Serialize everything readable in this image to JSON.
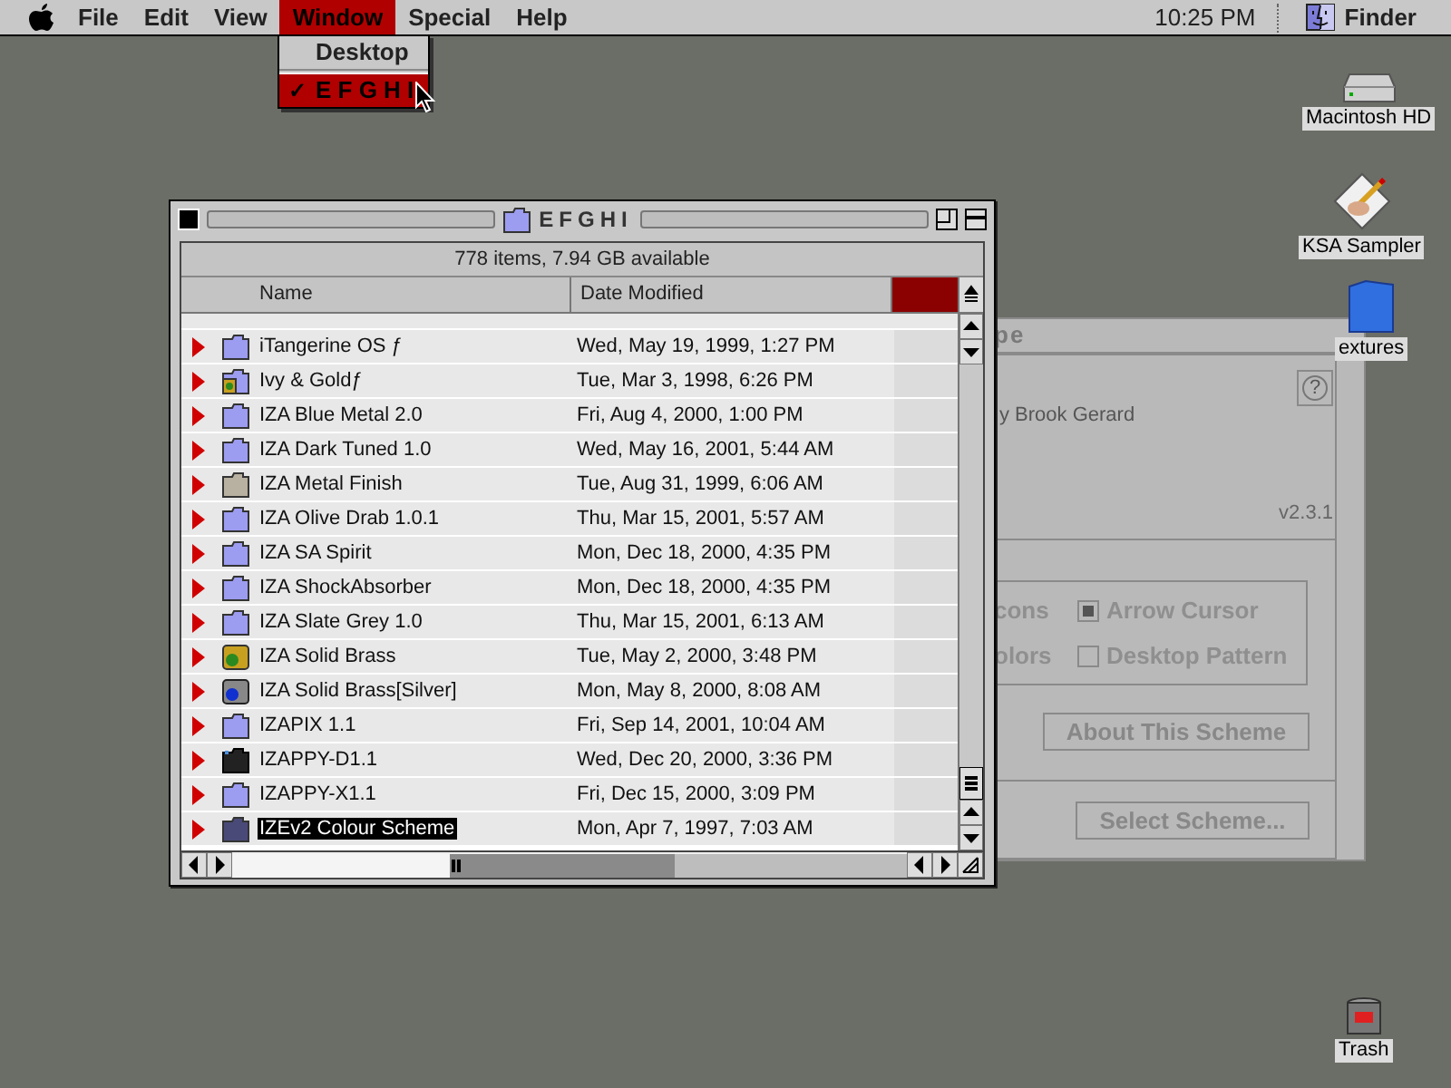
{
  "menu_bar": {
    "items": [
      {
        "label": "File",
        "selected": false
      },
      {
        "label": "Edit",
        "selected": false
      },
      {
        "label": "View",
        "selected": false
      },
      {
        "label": "Window",
        "selected": true
      },
      {
        "label": "Special",
        "selected": false
      },
      {
        "label": "Help",
        "selected": false
      }
    ],
    "clock": "10:25 PM",
    "app": "Finder"
  },
  "window_menu": {
    "items": [
      {
        "label": "Desktop",
        "checked": false,
        "highlighted": false
      },
      {
        "label": "E F G H I",
        "checked": true,
        "highlighted": true
      }
    ],
    "check_mark": "✓"
  },
  "finder_window": {
    "title": "EFGHI",
    "info": "778 items, 7.94 GB available",
    "columns": [
      "Name",
      "Date Modified"
    ],
    "rows": [
      {
        "name": "iTangerine OS ƒ",
        "date": "Wed, May 19, 1999, 1:27 PM",
        "kind": "folder",
        "selected": false
      },
      {
        "name": "Ivy & Goldƒ",
        "date": "Tue, Mar 3, 1998, 6:26 PM",
        "kind": "app-folder",
        "selected": false
      },
      {
        "name": "IZA Blue Metal 2.0",
        "date": "Fri, Aug 4, 2000, 1:00 PM",
        "kind": "folder",
        "selected": false
      },
      {
        "name": "IZA Dark Tuned 1.0",
        "date": "Wed, May 16, 2001, 5:44 AM",
        "kind": "folder",
        "selected": false
      },
      {
        "name": "IZA Metal Finish",
        "date": "Tue, Aug 31, 1999, 6:06 AM",
        "kind": "gray-folder",
        "selected": false
      },
      {
        "name": "IZA Olive Drab 1.0.1",
        "date": "Thu, Mar 15, 2001, 5:57 AM",
        "kind": "folder",
        "selected": false
      },
      {
        "name": "IZA SA Spirit",
        "date": "Mon, Dec 18, 2000, 4:35 PM",
        "kind": "folder",
        "selected": false
      },
      {
        "name": "IZA ShockAbsorber",
        "date": "Mon, Dec 18, 2000, 4:35 PM",
        "kind": "folder",
        "selected": false
      },
      {
        "name": "IZA Slate Grey 1.0",
        "date": "Thu, Mar 15, 2001, 6:13 AM",
        "kind": "folder",
        "selected": false
      },
      {
        "name": "IZA Solid Brass",
        "date": "Tue, May 2, 2000, 3:48 PM",
        "kind": "brass-app",
        "selected": false
      },
      {
        "name": "IZA Solid Brass[Silver]",
        "date": "Mon, May 8, 2000, 8:08 AM",
        "kind": "silver-app",
        "selected": false
      },
      {
        "name": "IZAPIX 1.1",
        "date": "Fri, Sep 14, 2001, 10:04 AM",
        "kind": "folder",
        "selected": false
      },
      {
        "name": "IZAPPY-D1.1",
        "date": "Wed, Dec 20, 2000, 3:36 PM",
        "kind": "black-folder",
        "selected": false
      },
      {
        "name": "IZAPPY-X1.1",
        "date": "Fri, Dec 15, 2000, 3:09 PM",
        "kind": "folder",
        "selected": false
      },
      {
        "name": "IZEv2 Colour Scheme",
        "date": "Mon, Apr 7, 1997, 7:03 AM",
        "kind": "folder",
        "selected": true
      }
    ]
  },
  "scheme_window": {
    "title": "pe",
    "help": "?",
    "author": "y Brook Gerard",
    "version": "v2.3.1",
    "options": [
      {
        "label": "cons",
        "kind": "text"
      },
      {
        "label": "Arrow Cursor",
        "kind": "checkbox",
        "checked": true
      },
      {
        "label": "olors",
        "kind": "text"
      },
      {
        "label": "Desktop Pattern",
        "kind": "checkbox",
        "checked": false
      }
    ],
    "buttons": [
      "About This Scheme",
      "Select Scheme..."
    ]
  },
  "desktop_icons": [
    {
      "label": "Macintosh HD",
      "kind": "disk"
    },
    {
      "label": "KSA Sampler",
      "kind": "document"
    },
    {
      "label": "extures",
      "kind": "folder"
    },
    {
      "label": "Trash",
      "kind": "trash"
    }
  ]
}
